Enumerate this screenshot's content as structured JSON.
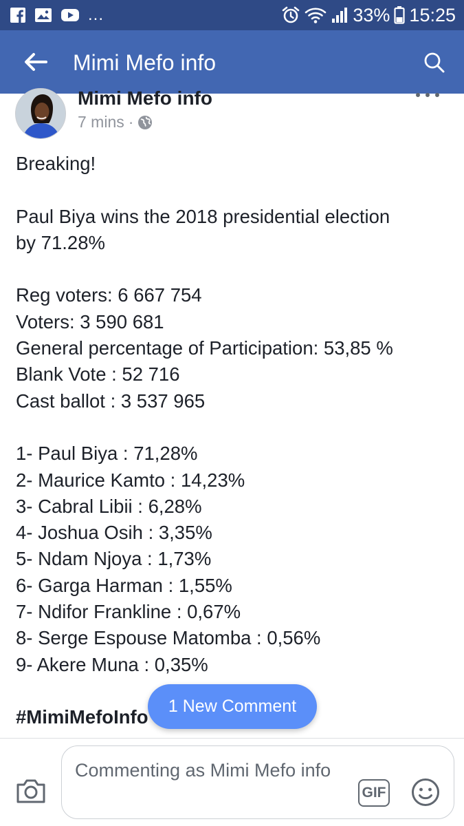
{
  "status_bar": {
    "overflow": "...",
    "battery": "33%",
    "time": "15:25",
    "icons": [
      "facebook-icon",
      "gallery-icon",
      "youtube-icon",
      "alarm-icon",
      "wifi-icon",
      "signal-icon",
      "battery-icon"
    ]
  },
  "app_bar": {
    "title": "Mimi Mefo info",
    "icons": [
      "back-arrow-icon",
      "search-icon"
    ],
    "color": "#4267b2"
  },
  "post": {
    "author": "Mimi Mefo info",
    "time": "7 mins",
    "separator": "·",
    "audience_icon": "globe-icon",
    "lines": {
      "breaking": "Breaking!",
      "headline_1": "Paul Biya wins the 2018 presidential election",
      "headline_2": "by 71.28%",
      "reg_voters": "Reg voters: 6 667 754",
      "voters": "Voters: 3 590 681",
      "participation": "General percentage of Participation: 53,85 %",
      "blank_vote": "Blank Vote : 52 716",
      "cast_ballot": "Cast ballot : 3 537 965"
    },
    "results": [
      "1- Paul Biya : 71,28%",
      "2- Maurice Kamto : 14,23%",
      "3- Cabral Libii : 6,28%",
      "4- Joshua Osih : 3,35%",
      "5- Ndam Njoya : 1,73%",
      "6- Garga Harman : 1,55%",
      "7- Ndifor Frankline : 0,67%",
      "8- Serge Espouse Matomba  : 0,56%",
      "9- Akere Muna : 0,35%"
    ],
    "hashtag": "#MimiMefoInfo"
  },
  "new_comment": {
    "label": "1 New Comment",
    "color": "#5b8ff9"
  },
  "composer": {
    "placeholder": "Commenting as Mimi Mefo info",
    "gif_label": "GIF",
    "icons": [
      "camera-icon",
      "gif-icon",
      "emoji-icon"
    ]
  }
}
